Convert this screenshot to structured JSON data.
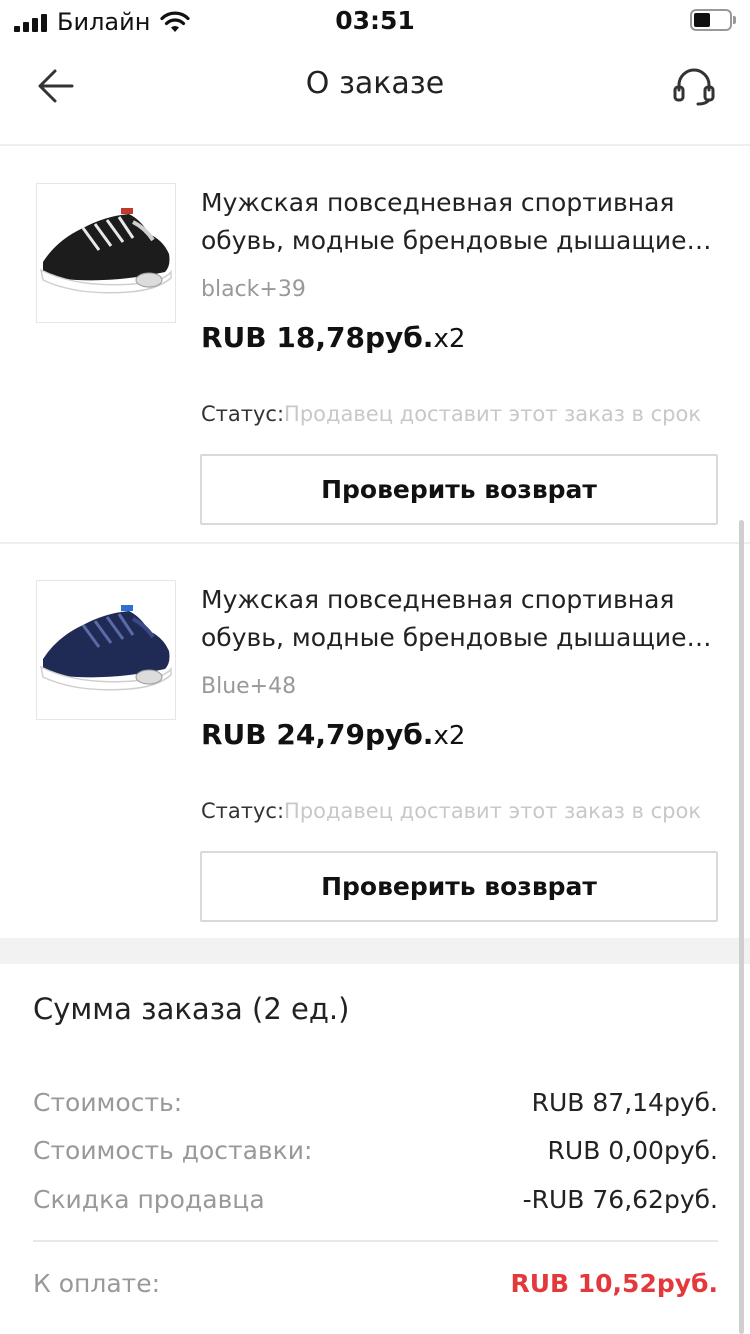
{
  "status_bar": {
    "carrier": "Билайн",
    "time": "03:51"
  },
  "nav": {
    "title": "О заказе",
    "back_icon": "arrow-left-icon",
    "support_icon": "headset-icon"
  },
  "items": [
    {
      "title_line1": "Мужская повседневная спортивная",
      "title_line2": "обувь, модные брендовые дышащие кроссовки",
      "variant": "black+39",
      "price": "RUB 18,78руб.",
      "quantity": "x2",
      "status_label": "Статус:",
      "status_value": "Продавец доставит этот заказ в срок",
      "return_button": "Проверить возврат",
      "shoe_color": "#1c1c1c",
      "stripe_color": "#e8e8e8"
    },
    {
      "title_line1": "Мужская повседневная спортивная",
      "title_line2": "обувь, модные брендовые дышащие кроссовки",
      "variant": "Blue+48",
      "price": "RUB 24,79руб.",
      "quantity": "x2",
      "status_label": "Статус:",
      "status_value": "Продавец доставит этот заказ в срок",
      "return_button": "Проверить возврат",
      "shoe_color": "#1f2a55",
      "stripe_color": "#5a6aa6"
    }
  ],
  "summary": {
    "title": "Сумма заказа (2 ед.)",
    "cost_label": "Стоимость:",
    "cost_value": "RUB 87,14руб.",
    "shipping_label": "Стоимость доставки:",
    "shipping_value": "RUB 0,00руб.",
    "discount_label": "Скидка продавца",
    "discount_value": "-RUB 76,62руб.",
    "total_label": "К оплате:",
    "total_value": "RUB 10,52руб.",
    "total_color": "#e4393c"
  }
}
